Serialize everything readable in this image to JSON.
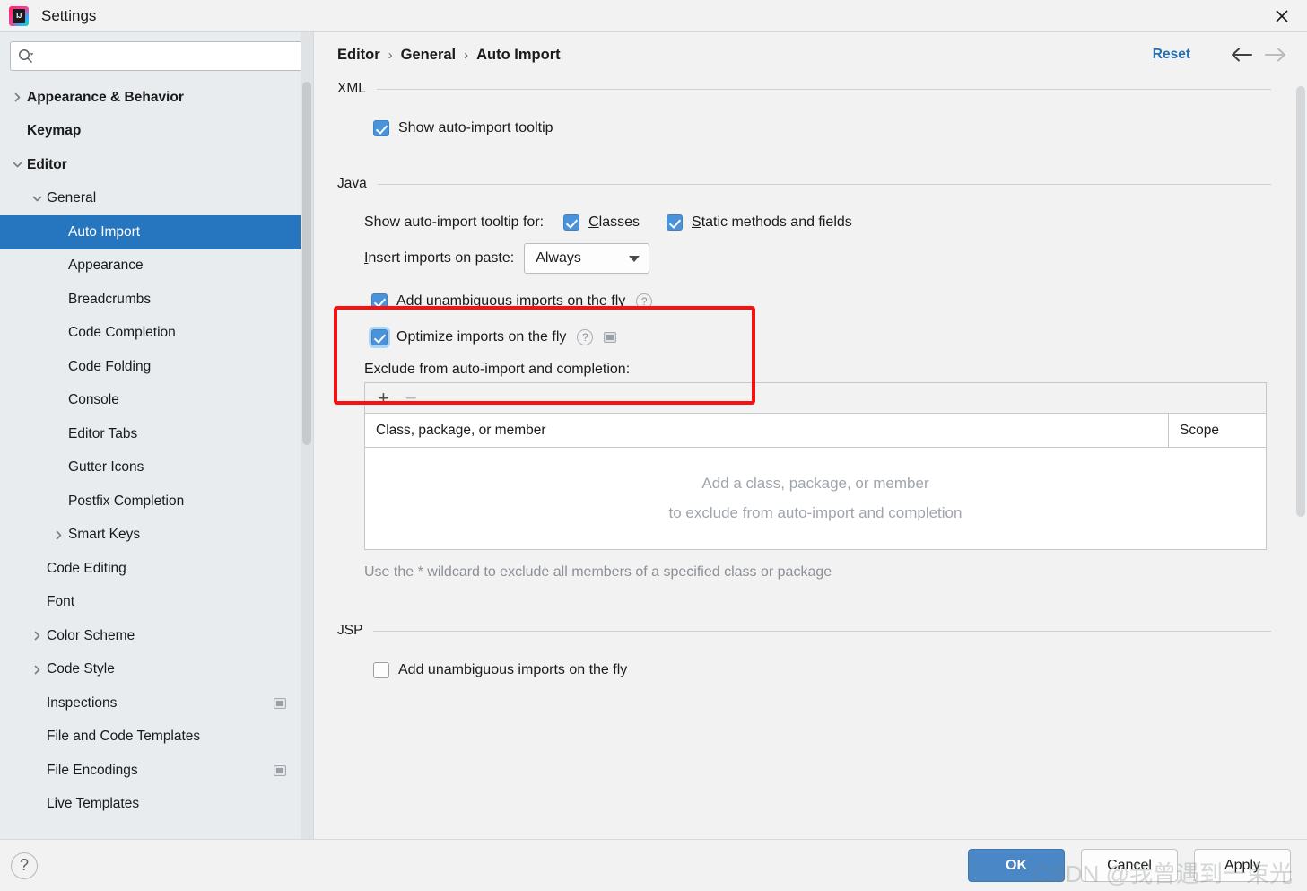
{
  "window": {
    "title": "Settings",
    "app_icon": "intellij-idea-logo",
    "close_icon": "close-icon"
  },
  "sidebar": {
    "search": {
      "placeholder": "",
      "value": "",
      "icon": "search-icon"
    },
    "items": [
      {
        "label": "Appearance & Behavior",
        "indent": 0,
        "arrow": "collapsed",
        "bold": true,
        "selected": false,
        "scope_icon": false
      },
      {
        "label": "Keymap",
        "indent": 0,
        "arrow": "none",
        "bold": true,
        "selected": false,
        "scope_icon": false
      },
      {
        "label": "Editor",
        "indent": 0,
        "arrow": "expanded",
        "bold": true,
        "selected": false,
        "scope_icon": false
      },
      {
        "label": "General",
        "indent": 1,
        "arrow": "expanded",
        "bold": false,
        "selected": false,
        "scope_icon": false
      },
      {
        "label": "Auto Import",
        "indent": 2,
        "arrow": "none",
        "bold": false,
        "selected": true,
        "scope_icon": false
      },
      {
        "label": "Appearance",
        "indent": 2,
        "arrow": "none",
        "bold": false,
        "selected": false,
        "scope_icon": false
      },
      {
        "label": "Breadcrumbs",
        "indent": 2,
        "arrow": "none",
        "bold": false,
        "selected": false,
        "scope_icon": false
      },
      {
        "label": "Code Completion",
        "indent": 2,
        "arrow": "none",
        "bold": false,
        "selected": false,
        "scope_icon": false
      },
      {
        "label": "Code Folding",
        "indent": 2,
        "arrow": "none",
        "bold": false,
        "selected": false,
        "scope_icon": false
      },
      {
        "label": "Console",
        "indent": 2,
        "arrow": "none",
        "bold": false,
        "selected": false,
        "scope_icon": false
      },
      {
        "label": "Editor Tabs",
        "indent": 2,
        "arrow": "none",
        "bold": false,
        "selected": false,
        "scope_icon": false
      },
      {
        "label": "Gutter Icons",
        "indent": 2,
        "arrow": "none",
        "bold": false,
        "selected": false,
        "scope_icon": false
      },
      {
        "label": "Postfix Completion",
        "indent": 2,
        "arrow": "none",
        "bold": false,
        "selected": false,
        "scope_icon": false
      },
      {
        "label": "Smart Keys",
        "indent": 2,
        "arrow": "collapsed",
        "bold": false,
        "selected": false,
        "scope_icon": false
      },
      {
        "label": "Code Editing",
        "indent": 1,
        "arrow": "none",
        "bold": false,
        "selected": false,
        "scope_icon": false
      },
      {
        "label": "Font",
        "indent": 1,
        "arrow": "none",
        "bold": false,
        "selected": false,
        "scope_icon": false
      },
      {
        "label": "Color Scheme",
        "indent": 1,
        "arrow": "collapsed",
        "bold": false,
        "selected": false,
        "scope_icon": false
      },
      {
        "label": "Code Style",
        "indent": 1,
        "arrow": "collapsed",
        "bold": false,
        "selected": false,
        "scope_icon": false
      },
      {
        "label": "Inspections",
        "indent": 1,
        "arrow": "none",
        "bold": false,
        "selected": false,
        "scope_icon": true
      },
      {
        "label": "File and Code Templates",
        "indent": 1,
        "arrow": "none",
        "bold": false,
        "selected": false,
        "scope_icon": false
      },
      {
        "label": "File Encodings",
        "indent": 1,
        "arrow": "none",
        "bold": false,
        "selected": false,
        "scope_icon": true
      },
      {
        "label": "Live Templates",
        "indent": 1,
        "arrow": "none",
        "bold": false,
        "selected": false,
        "scope_icon": false
      }
    ]
  },
  "header": {
    "breadcrumbs": [
      "Editor",
      "General",
      "Auto Import"
    ],
    "separator": "›",
    "reset_label": "Reset",
    "back_icon": "arrow-left-icon",
    "forward_icon": "arrow-right-icon"
  },
  "main": {
    "xml": {
      "title": "XML",
      "show_tooltip": {
        "label": "Show auto-import tooltip",
        "checked": true
      }
    },
    "java": {
      "title": "Java",
      "tooltip_for_label": "Show auto-import tooltip for:",
      "classes": {
        "label": "Classes",
        "mnemonic": "C",
        "checked": true
      },
      "static_methods": {
        "label": "Static methods and fields",
        "mnemonic": "S",
        "checked": true
      },
      "insert_imports_label": "Insert imports on paste:",
      "insert_imports_mnemonic": "I",
      "insert_imports_value": "Always",
      "add_unambiguous": {
        "label": "Add unambiguous imports on the fly",
        "checked": true,
        "help": "?"
      },
      "optimize_imports": {
        "label": "Optimize imports on the fly",
        "checked": true,
        "help": "?",
        "focused": true,
        "scope_icon": true
      },
      "exclude_label": "Exclude from auto-import and completion:",
      "table": {
        "add_icon": "plus-icon",
        "remove_icon": "minus-icon",
        "columns": [
          "Class, package, or member",
          "Scope"
        ],
        "rows": [],
        "empty_line1": "Add a class, package, or member",
        "empty_line2": "to exclude from auto-import and completion"
      },
      "wildcard_hint": "Use the * wildcard to exclude all members of a specified class or package"
    },
    "jsp": {
      "title": "JSP",
      "add_unambiguous": {
        "label": "Add unambiguous imports on the fly",
        "checked": false
      }
    }
  },
  "footer": {
    "help_icon": "?",
    "ok_label": "OK",
    "cancel_label": "Cancel",
    "apply_label": "Apply"
  },
  "watermark": {
    "text": "CSDN @我曾遇到一束光"
  },
  "colors": {
    "accent_blue": "#2675bf",
    "checkbox_blue": "#4a92d9",
    "link_blue": "#2470b3",
    "highlight_red": "#fb1010",
    "sidebar_bg": "#e8ecef",
    "content_bg": "#f2f2f2"
  }
}
